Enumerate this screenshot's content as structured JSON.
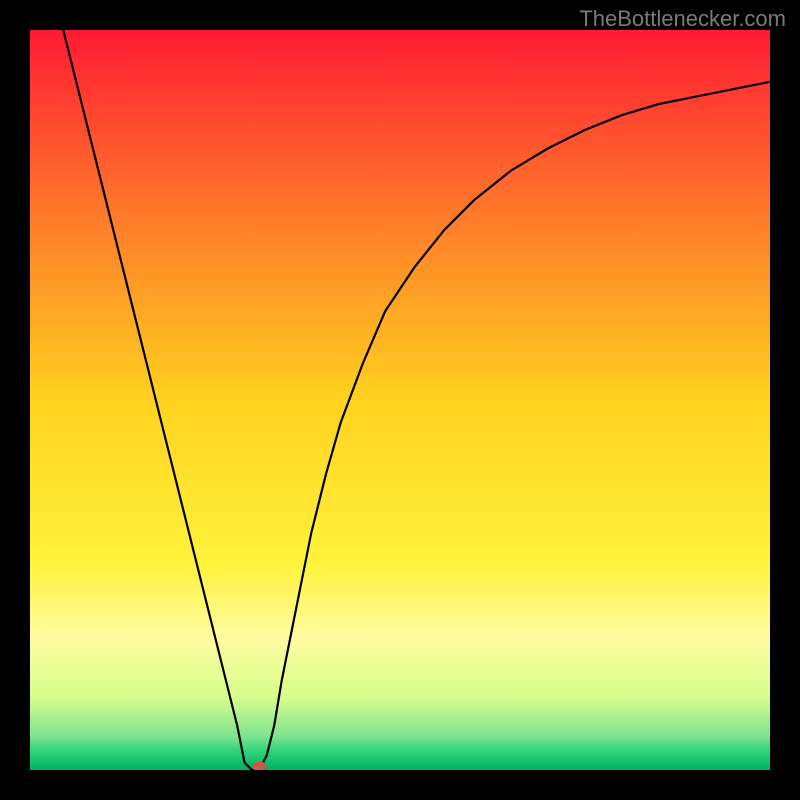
{
  "watermark": "TheBottlenecker.com",
  "chart_data": {
    "type": "line",
    "title": "",
    "xlabel": "",
    "ylabel": "",
    "xlim": [
      0,
      100
    ],
    "ylim": [
      0,
      100
    ],
    "x": [
      0,
      2,
      4,
      6,
      8,
      10,
      12,
      14,
      16,
      18,
      20,
      22,
      24,
      26,
      28,
      29,
      30,
      31,
      32,
      33,
      34,
      36,
      38,
      40,
      42,
      45,
      48,
      52,
      56,
      60,
      65,
      70,
      75,
      80,
      85,
      90,
      95,
      100
    ],
    "values": [
      118,
      110,
      102,
      94,
      86,
      78,
      70,
      62,
      54,
      46,
      38,
      30,
      22,
      14,
      6,
      1,
      0,
      0,
      2,
      6,
      12,
      22,
      32,
      40,
      47,
      55,
      62,
      68,
      73,
      77,
      81,
      84,
      86.5,
      88.5,
      90,
      91,
      92,
      93
    ],
    "marker": {
      "x": 31,
      "y": 0.5,
      "color": "#c95a4a"
    },
    "background_gradient": [
      {
        "stop": 0.0,
        "color": "#ff1a33"
      },
      {
        "stop": 0.25,
        "color": "#ff7a2a"
      },
      {
        "stop": 0.5,
        "color": "#ffd21f"
      },
      {
        "stop": 0.72,
        "color": "#fff23a"
      },
      {
        "stop": 0.82,
        "color": "#fffca0"
      },
      {
        "stop": 0.9,
        "color": "#d8ff8c"
      },
      {
        "stop": 0.955,
        "color": "#7de38f"
      },
      {
        "stop": 0.975,
        "color": "#2bd47a"
      },
      {
        "stop": 1.0,
        "color": "#00b060"
      }
    ]
  }
}
